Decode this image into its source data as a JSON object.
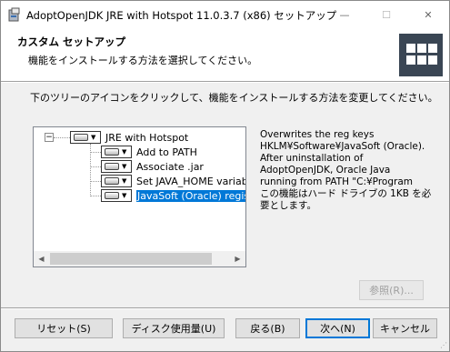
{
  "window": {
    "title": "AdoptOpenJDK JRE with Hotspot 11.0.3.7 (x86) セットアップ",
    "minimize_symbol": "—",
    "maximize_symbol": "☐",
    "close_symbol": "✕"
  },
  "header": {
    "title": "カスタム セットアップ",
    "description": "機能をインストールする方法を選択してください。"
  },
  "instruction": "下のツリーのアイコンをクリックして、機能をインストールする方法を変更してください。",
  "tree": {
    "expander_symbol": "−",
    "root": "JRE with Hotspot",
    "children": [
      "Add to PATH",
      "Associate .jar",
      "Set JAVA_HOME variable",
      "JavaSoft (Oracle) registry keys"
    ],
    "selected_index": 3,
    "scroll_left": "◀",
    "scroll_right": "▶"
  },
  "info_lines": [
    "Overwrites the reg keys",
    "HKLM¥Software¥JavaSoft (Oracle).",
    "After uninstallation of",
    "AdoptOpenJDK, Oracle Java",
    "running from PATH \"C:¥Program",
    "この機能はハード ドライブの 1KB を必",
    "要とします。"
  ],
  "buttons": {
    "browse": "参照(R)...",
    "reset": "リセット(S)",
    "disk_usage": "ディスク使用量(U)",
    "back": "戻る(B)",
    "next": "次へ(N)",
    "cancel": "キャンセル"
  },
  "colors": {
    "selection": "#0078d7",
    "logo_bg": "#3a4654"
  }
}
